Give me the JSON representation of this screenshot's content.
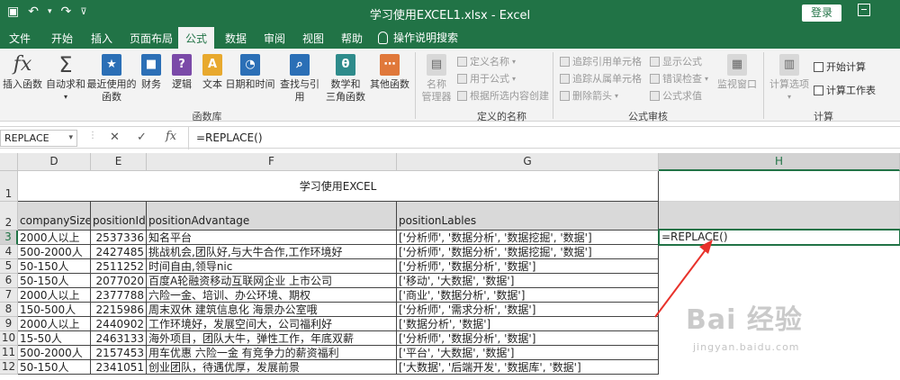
{
  "titlebar": {
    "title": "学习使用EXCEL1.xlsx - Excel",
    "login": "登录"
  },
  "tabs": [
    "文件",
    "开始",
    "插入",
    "页面布局",
    "公式",
    "数据",
    "审阅",
    "视图",
    "帮助"
  ],
  "tab_search": "操作说明搜索",
  "ribbon": {
    "function_library": {
      "label": "函数库",
      "buttons": [
        "插入函数",
        "自动求和",
        "最近使用的",
        "函数",
        "财务",
        "逻辑",
        "文本",
        "日期和时间",
        "查找与引用",
        "数学和",
        "三角函数",
        "其他函数"
      ]
    },
    "defined_names": {
      "label": "定义的名称",
      "manager_line1": "名称",
      "manager_line2": "管理器",
      "items": [
        "定义名称",
        "用于公式",
        "根据所选内容创建"
      ]
    },
    "formula_auditing": {
      "label": "公式审核",
      "items": [
        "追踪引用单元格",
        "追踪从属单元格",
        "删除箭头",
        "显示公式",
        "错误检查",
        "公式求值"
      ],
      "watch_window": "监视窗口"
    },
    "calculation": {
      "label": "计算",
      "options": "计算选项",
      "start_calc": "开始计算",
      "calc_sheet": "计算工作表"
    }
  },
  "formula_bar": {
    "name_box": "REPLACE",
    "cancel": "✕",
    "confirm": "✓",
    "fx": "fx",
    "formula": "=REPLACE()"
  },
  "sheet": {
    "columns": [
      "D",
      "E",
      "F",
      "G",
      "H"
    ],
    "row_numbers": [
      "1",
      "2",
      "3",
      "4",
      "5",
      "6",
      "7",
      "8",
      "9",
      "10",
      "11",
      "12"
    ],
    "title": "学习使用EXCEL",
    "headers": [
      "companySize",
      "positionId",
      "positionAdvantage",
      "positionLables"
    ],
    "rows": [
      [
        "2000人以上",
        "2537336",
        "知名平台",
        "['分析师', '数据分析', '数据挖掘', '数据']"
      ],
      [
        "500-2000人",
        "2427485",
        "挑战机会,团队好,与大牛合作,工作环境好",
        "['分析师', '数据分析', '数据挖掘', '数据']"
      ],
      [
        "50-150人",
        "2511252",
        "时间自由,领导nic",
        "['分析师', '数据分析', '数据']"
      ],
      [
        "50-150人",
        "2077020",
        "百度A轮融资移动互联网企业 上市公司",
        "['移动', '大数据', '数据']"
      ],
      [
        "2000人以上",
        "2377788",
        "六险一金、培训、办公环境、期权",
        "['商业', '数据分析', '数据']"
      ],
      [
        "150-500人",
        "2215986",
        "周末双休 建筑信息化 海景办公室哦",
        "['分析师', '需求分析', '数据']"
      ],
      [
        "2000人以上",
        "2440902",
        "工作环境好，发展空间大，公司福利好",
        "['数据分析', '数据']"
      ],
      [
        "15-50人",
        "2463133",
        "海外项目，团队大牛，弹性工作，年底双薪",
        "['分析师', '数据分析', '数据']"
      ],
      [
        "500-2000人",
        "2157453",
        "用车优惠 六险一金 有竞争力的薪资福利",
        "['平台', '大数据', '数据']"
      ],
      [
        "50-150人",
        "2341051",
        "创业团队，待遇优厚，发展前景",
        "['大数据', '后端开发', '数据库', '数据']"
      ]
    ],
    "active_cell_value": "=REPLACE()"
  },
  "watermark": {
    "main": "Bai 经验",
    "sub": "jingyan.baidu.com"
  },
  "colors": {
    "excel_green": "#217346",
    "annotation_red": "#e8322b"
  }
}
